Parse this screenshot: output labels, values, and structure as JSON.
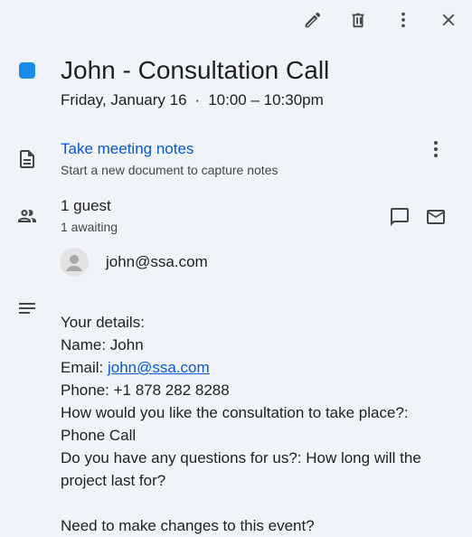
{
  "toolbar": {
    "edit_icon": "pencil-icon",
    "delete_icon": "trash-icon",
    "more_icon": "more-vert-icon",
    "close_icon": "close-icon"
  },
  "event": {
    "color": "#1a8be8",
    "title": "John - Consultation Call",
    "date": "Friday, January 16",
    "separator": "·",
    "time": "10:00 – 10:30pm"
  },
  "notes": {
    "link": "Take meeting notes",
    "sub": "Start a new document to capture notes"
  },
  "guests": {
    "count": "1 guest",
    "awaiting": "1 awaiting",
    "list": [
      {
        "email": "john@ssa.com"
      }
    ]
  },
  "description": {
    "line1": "Your details:",
    "line2": "Name: John",
    "email_label": "Email: ",
    "email_link": "john@ssa.com",
    "line4": "Phone: +1 878 282 8288",
    "line5": "How would you like the consultation to take place?:",
    "line6": "Phone Call",
    "line7": "Do you have any questions for us?: How long will the project last for?",
    "line8": "Need to make changes to this event?"
  }
}
